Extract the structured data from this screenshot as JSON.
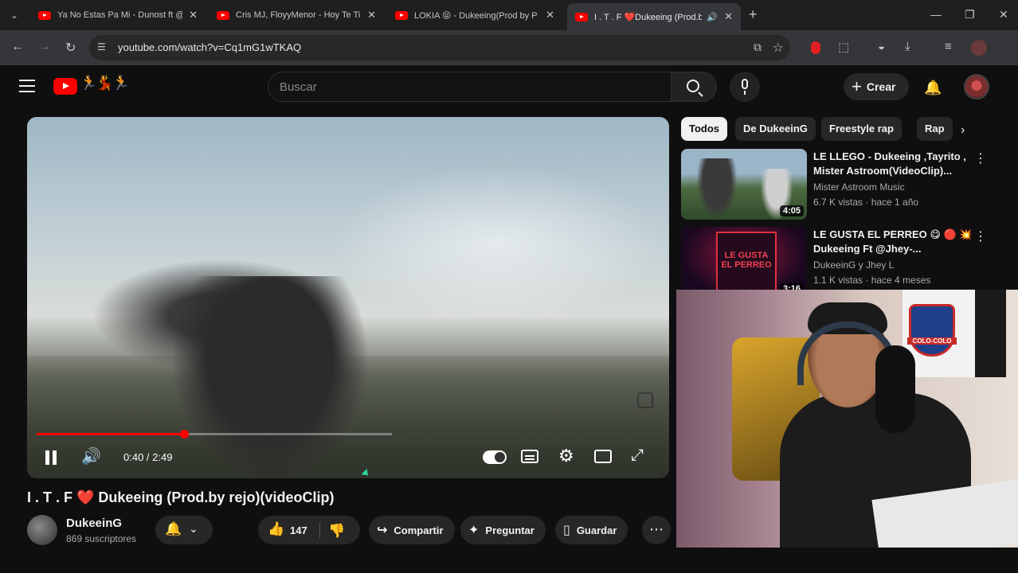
{
  "browser": {
    "tabs": [
      {
        "title": "Ya No Estas Pa Mi - Dunost ft @",
        "active": false
      },
      {
        "title": "Cris MJ, FloyyMenor - Hoy Te Ti",
        "active": false
      },
      {
        "title": "LOKIA 😝 - Dukeeing(Prod by P",
        "active": false
      },
      {
        "title": "I . T . F ❤️Dukeeing (Prod.b",
        "active": true
      }
    ],
    "url": "youtube.com/watch?v=Cq1mG1wTKAQ"
  },
  "header": {
    "logo_doodle": "🏃💃🏃",
    "search_placeholder": "Buscar",
    "create_label": "Crear"
  },
  "player": {
    "current_time": "0:40",
    "duration": "2:49",
    "time_display": "0:40 / 2:49",
    "progress_fraction": 0.237
  },
  "video": {
    "title": "I . T . F ❤️ Dukeeing (Prod.by rejo)(videoClip)",
    "channel_name": "DukeeinG",
    "subscribers": "869 suscriptores",
    "likes": "147",
    "share_label": "Compartir",
    "ask_label": "Preguntar",
    "save_label": "Guardar"
  },
  "chips": [
    "Todos",
    "De DukeeinG",
    "Freestyle rap",
    "Rap"
  ],
  "recommendations": [
    {
      "title": "LE LLEGO - Dukeeing ,Tayrito , Mister Astroom(VideoClip)...",
      "channel": "Mister Astroom Music",
      "meta": "6.7 K vistas · hace 1 año",
      "duration": "4:05"
    },
    {
      "title": "LE GUSTA EL PERREO 😋 🔴 💥 Dukeeing Ft @Jhey-...",
      "channel": "DukeeinG y Jhey L",
      "meta": "1.1 K vistas · hace 4 meses",
      "duration": "3:16",
      "thumb_text": "LE GUSTA EL PERREO"
    }
  ],
  "webcam": {
    "flag_text": "COLO-COLO"
  }
}
